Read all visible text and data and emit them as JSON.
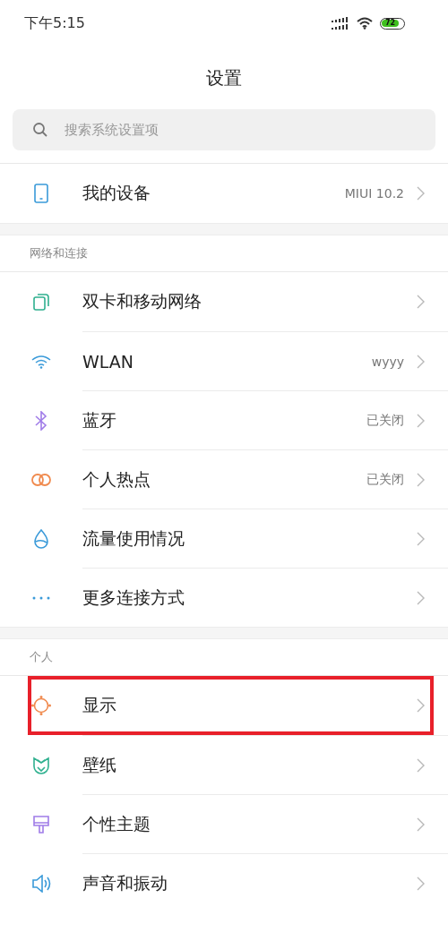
{
  "status_bar": {
    "time": "下午5:15",
    "battery": "72"
  },
  "title": "设置",
  "search": {
    "placeholder": "搜索系统设置项"
  },
  "groups": [
    {
      "items": [
        {
          "kind": "device",
          "label": "我的设备",
          "value": "MIUI 10.2",
          "highlighted": false
        }
      ]
    },
    {
      "header": "网络和连接",
      "items": [
        {
          "kind": "sim",
          "label": "双卡和移动网络",
          "highlighted": false
        },
        {
          "kind": "wifi",
          "label": "WLAN",
          "value": "wyyy",
          "highlighted": false
        },
        {
          "kind": "bluetooth",
          "label": "蓝牙",
          "value": "已关闭",
          "highlighted": false
        },
        {
          "kind": "hotspot",
          "label": "个人热点",
          "value": "已关闭",
          "highlighted": false
        },
        {
          "kind": "drop",
          "label": "流量使用情况",
          "highlighted": false
        },
        {
          "kind": "dots",
          "label": "更多连接方式",
          "highlighted": false
        }
      ]
    },
    {
      "header": "个人",
      "items": [
        {
          "kind": "sun",
          "label": "显示",
          "highlighted": true
        },
        {
          "kind": "tulip",
          "label": "壁纸",
          "highlighted": false
        },
        {
          "kind": "brush",
          "label": "个性主题",
          "highlighted": false
        },
        {
          "kind": "speaker",
          "label": "声音和振动",
          "highlighted": false
        }
      ]
    }
  ]
}
